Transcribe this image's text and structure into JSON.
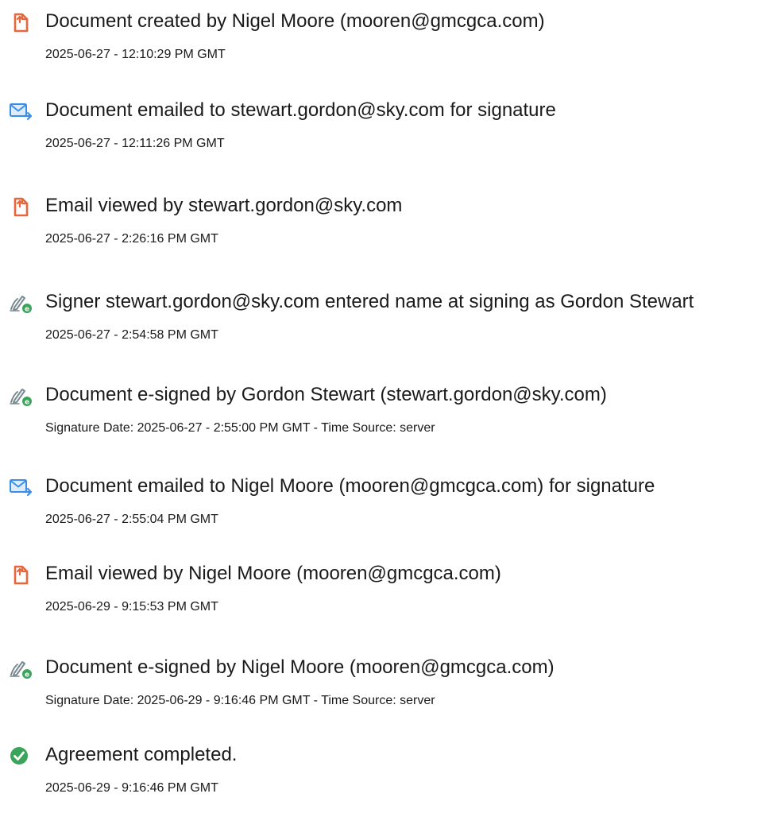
{
  "colors": {
    "document_icon": "#e8663d",
    "email_icon": "#3b8ee8",
    "sign_icon_pen": "#7a8a92",
    "sign_icon_badge": "#3aa55a",
    "complete_icon": "#3aa55a",
    "text": "#1a1a1a"
  },
  "events": [
    {
      "icon": "document-icon",
      "title": "Document created by Nigel Moore (mooren@gmcgca.com)",
      "sub": "2025-06-27 - 12:10:29 PM GMT"
    },
    {
      "icon": "email-icon",
      "title": "Document emailed to stewart.gordon@sky.com for signature",
      "sub": "2025-06-27 - 12:11:26 PM GMT"
    },
    {
      "icon": "document-icon",
      "title": "Email viewed by stewart.gordon@sky.com",
      "sub": "2025-06-27 - 2:26:16 PM GMT"
    },
    {
      "icon": "sign-icon",
      "title": "Signer stewart.gordon@sky.com entered name at signing as Gordon Stewart",
      "sub": "2025-06-27 - 2:54:58 PM GMT"
    },
    {
      "icon": "sign-icon",
      "title": "Document e-signed by Gordon Stewart (stewart.gordon@sky.com)",
      "sub": "Signature Date: 2025-06-27 - 2:55:00 PM GMT - Time Source: server"
    },
    {
      "icon": "email-icon",
      "title": "Document emailed to Nigel Moore (mooren@gmcgca.com) for signature",
      "sub": "2025-06-27 - 2:55:04 PM GMT"
    },
    {
      "icon": "document-icon",
      "title": "Email viewed by Nigel Moore (mooren@gmcgca.com)",
      "sub": "2025-06-29 - 9:15:53 PM GMT"
    },
    {
      "icon": "sign-icon",
      "title": "Document e-signed by Nigel Moore (mooren@gmcgca.com)",
      "sub": "Signature Date: 2025-06-29 - 9:16:46 PM GMT - Time Source: server"
    },
    {
      "icon": "complete-icon",
      "title": "Agreement completed.",
      "sub": "2025-06-29 - 9:16:46 PM GMT"
    }
  ]
}
